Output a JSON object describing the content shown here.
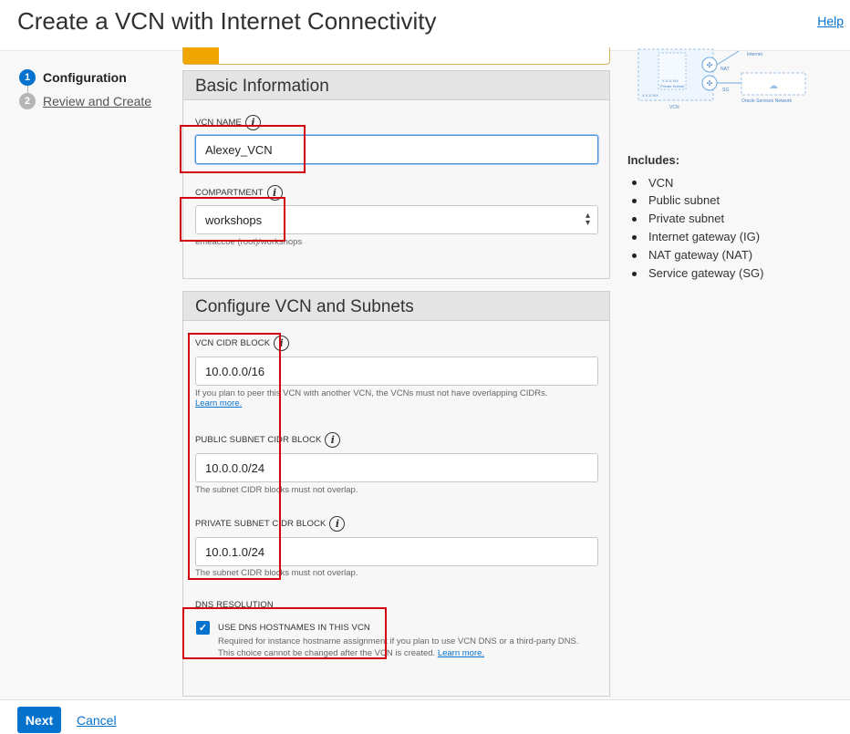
{
  "header": {
    "title": "Create a VCN with Internet Connectivity",
    "help": "Help"
  },
  "steps": [
    {
      "num": "1",
      "label": "Configuration"
    },
    {
      "num": "2",
      "label": "Review and Create"
    }
  ],
  "basic_info": {
    "title": "Basic Information",
    "vcn_name_label": "VCN NAME",
    "vcn_name_value": "Alexey_VCN",
    "compartment_label": "COMPARTMENT",
    "compartment_value": "workshops",
    "compartment_path": "emeaccoe (root)/workshops"
  },
  "configure": {
    "title": "Configure VCN and Subnets",
    "vcn_cidr_label": "VCN CIDR BLOCK",
    "vcn_cidr_value": "10.0.0.0/16",
    "vcn_cidr_hint": "If you plan to peer this VCN with another VCN, the VCNs must not have overlapping CIDRs.",
    "learn_more": "Learn more.",
    "public_label": "PUBLIC SUBNET CIDR BLOCK",
    "public_value": "10.0.0.0/24",
    "public_hint": "The subnet CIDR blocks must not overlap.",
    "private_label": "PRIVATE SUBNET CIDR BLOCK",
    "private_value": "10.0.1.0/24",
    "private_hint": "The subnet CIDR blocks must not overlap.",
    "dns_label": "DNS RESOLUTION",
    "dns_checkbox": "USE DNS HOSTNAMES IN THIS VCN",
    "dns_hint1": "Required for instance hostname assignment if you plan to use VCN DNS or a third-party DNS.",
    "dns_hint2": "This choice cannot be changed after the VCN is created.",
    "dns_checked": true
  },
  "diagram": {
    "internet": "Internet",
    "nat": "NAT",
    "sg": "SG",
    "vcn": "VCN",
    "oracle_services": "Oracle Services Network",
    "cidr1": "X.X.X.X/X",
    "private_subnet": "Private Subnet"
  },
  "includes": {
    "heading": "Includes:",
    "items": [
      "VCN",
      "Public subnet",
      "Private subnet",
      "Internet gateway (IG)",
      "NAT gateway (NAT)",
      "Service gateway (SG)"
    ]
  },
  "footer": {
    "next": "Next",
    "cancel": "Cancel"
  },
  "colors": {
    "accent": "#0572ce",
    "highlight": "#d4000f",
    "warning": "#f0a500"
  }
}
